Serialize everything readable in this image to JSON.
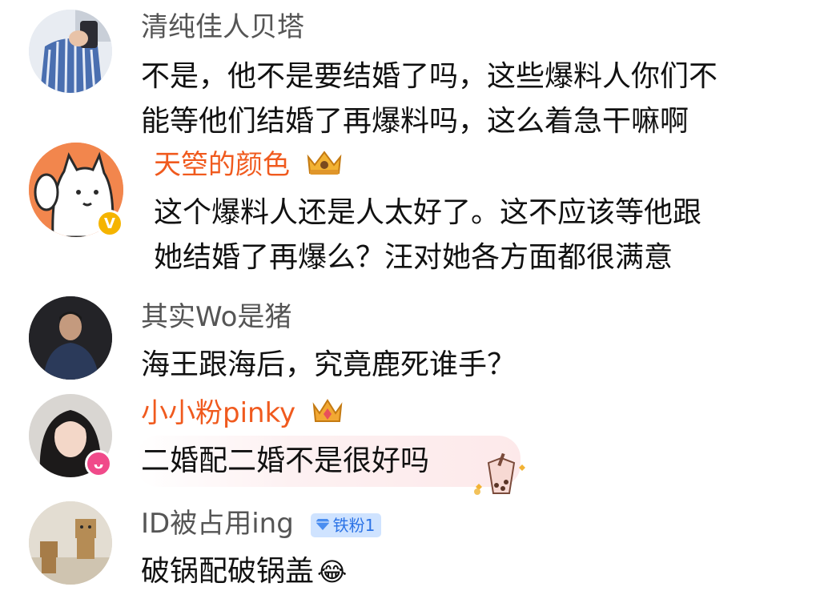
{
  "comments": [
    {
      "username": "清纯佳人贝塔",
      "username_color": "#555555",
      "lines": [
        "不是，他不是要结婚了吗，这些爆料人你们不",
        "能等他们结婚了再爆料吗，这么着急干嘛啊"
      ]
    },
    {
      "username": "天箜的颜色",
      "username_color": "#f05a1e",
      "badge": "crown-icon",
      "avatar_badge": "verified-v-icon",
      "lines": [
        "这个爆料人还是人太好了。这不应该等他跟",
        "她结婚了再爆么？汪对她各方面都很满意"
      ]
    },
    {
      "username": "其实Wo是猪",
      "username_color": "#555555",
      "lines": [
        "海王跟海后，究竟鹿死谁手？"
      ]
    },
    {
      "username": "小小粉pinky",
      "username_color": "#f05a1e",
      "badge": "crown-icon",
      "avatar_badge": "pink-rabbit-icon",
      "lines": [
        "二婚配二婚不是很好吗"
      ],
      "bubble_sticker": "bubble-tea-icon"
    },
    {
      "username": "ID被占用ing",
      "username_color": "#555555",
      "fan_badge": "铁粉1",
      "lines": [
        "破锅配破锅盖"
      ],
      "emoji": "😂"
    }
  ],
  "colors": {
    "vip_name": "#f05a1e",
    "normal_name": "#555555",
    "text": "#111111"
  }
}
